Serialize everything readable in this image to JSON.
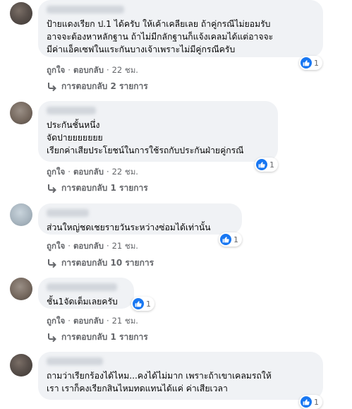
{
  "comments": [
    {
      "text": "ป้ายแดงเรียก ป.1 ได้ครับ ให้เค้าเคลียเลย ถ้าคู่กรณีไม่ยอมรับ\nอาจจะต้องหาหลักฐาน ถ้าไม่มีกลักฐานก็แจ้งเคลมได้แต่อาจจะ\nมีค่าแอ็คเซฟในแระกันบางเจ้าเพราะไม่มีคู่กรณีครับ",
      "like_label": "ถูกใจ",
      "reply_label": "ตอบกลับ",
      "time": "22 ชม.",
      "reactions": "1",
      "replies_text": "การตอบกลับ 2 รายการ"
    },
    {
      "text": "ประกันชั้นหนึ่ง\nจัดปายยยยยยย\nเรียกค่าเสียประโยชน์ในการใช้รถกับประกันฝ่ายคู่กรณี",
      "like_label": "ถูกใจ",
      "reply_label": "ตอบกลับ",
      "time": "22 ชม.",
      "reactions": "1",
      "replies_text": "การตอบกลับ 1 รายการ"
    },
    {
      "text": "ส่วนใหญ่ชดเชยรายวันระหว่างซ่อมได้เท่านั้น",
      "like_label": "ถูกใจ",
      "reply_label": "ตอบกลับ",
      "time": "21 ชม.",
      "reactions": "1",
      "replies_text": "การตอบกลับ 10 รายการ"
    },
    {
      "text": "ชั้น1จัดเต็มเลยครับ",
      "like_label": "ถูกใจ",
      "reply_label": "ตอบกลับ",
      "time": "21 ชม.",
      "reactions": "1",
      "replies_text": "การตอบกลับ 1 รายการ"
    },
    {
      "text": "ถามว่าเรียกร้องได้ไหม...คงได้ไม่มาก เพราะถ้าเขาเคลมรถให้\nเรา เราก็คงเรียกสินไหมทดแทนได้แค่ ค่าเสียเวลา",
      "reactions": "1"
    }
  ],
  "icons": {
    "like": "thumbs-up-icon",
    "reply": "reply-arrow-icon"
  },
  "colors": {
    "like_blue": "#1877f2",
    "bubble": "#f0f2f5",
    "meta": "#65676b"
  }
}
